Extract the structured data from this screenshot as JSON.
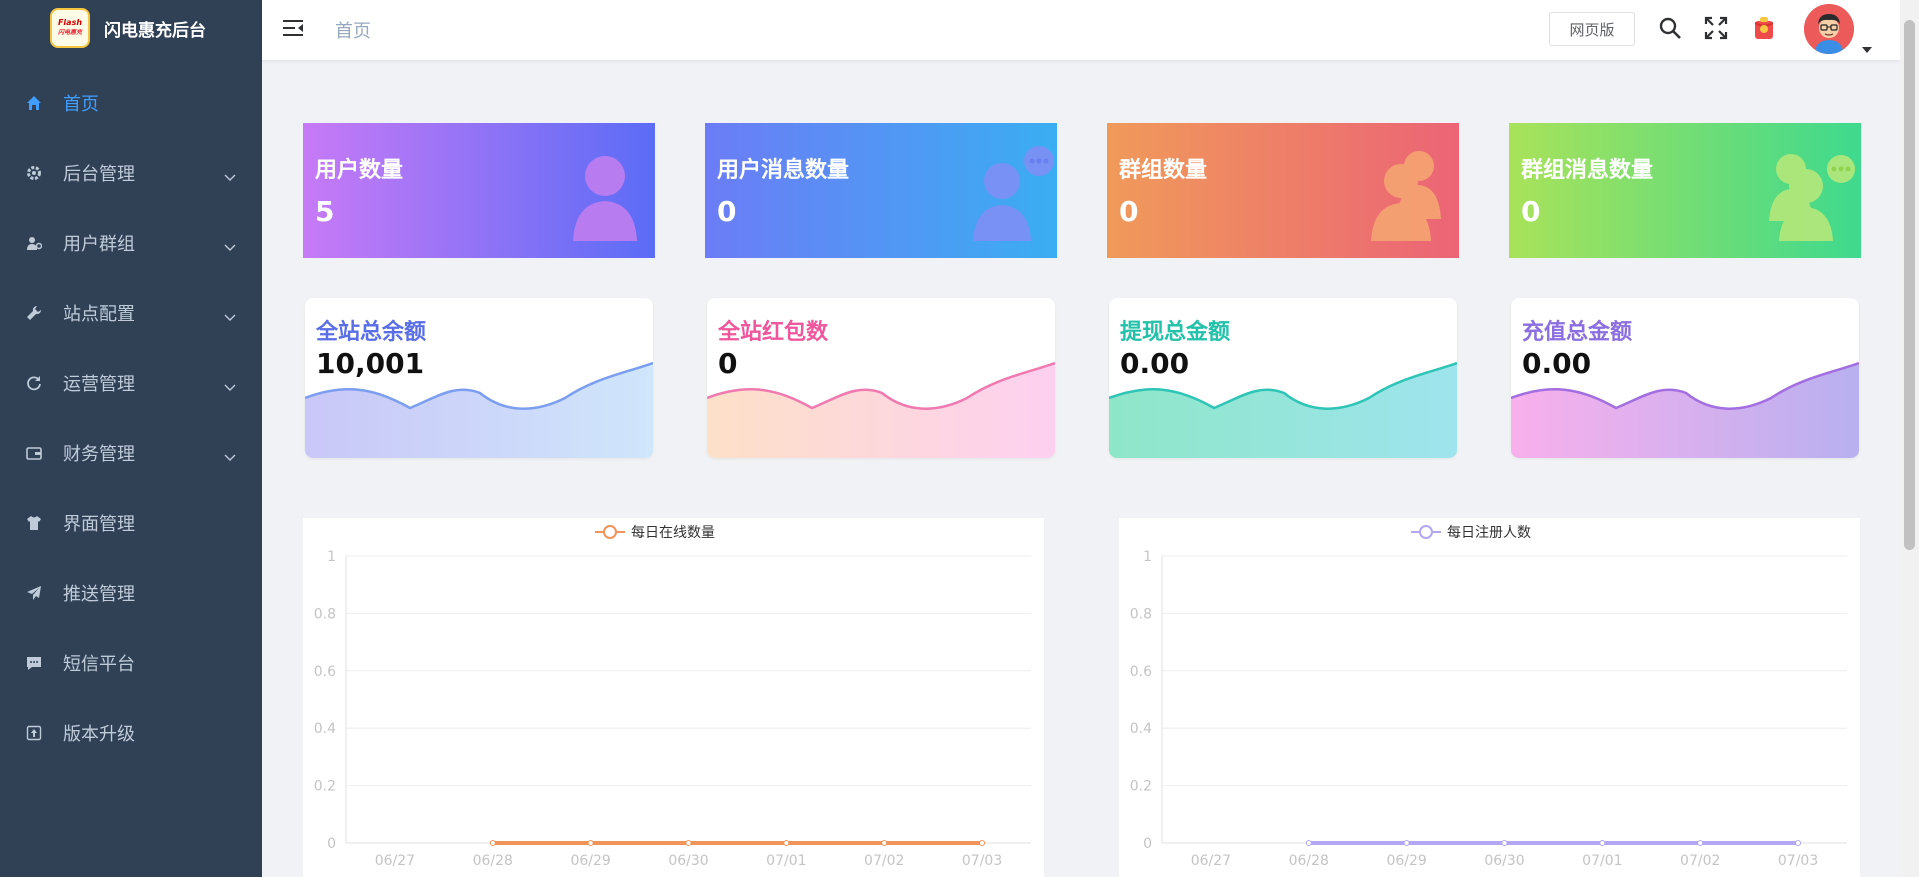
{
  "app": {
    "title": "闪电惠充后台",
    "logo_text": "Flash",
    "logo_sub": "闪电惠充"
  },
  "sidebar": {
    "items": [
      {
        "label": "首页",
        "icon": "home-icon",
        "active": true,
        "has_children": false
      },
      {
        "label": "后台管理",
        "icon": "gear-icon",
        "active": false,
        "has_children": true
      },
      {
        "label": "用户群组",
        "icon": "user-group-icon",
        "active": false,
        "has_children": true
      },
      {
        "label": "站点配置",
        "icon": "wrench-icon",
        "active": false,
        "has_children": true
      },
      {
        "label": "运营管理",
        "icon": "refresh-icon",
        "active": false,
        "has_children": true
      },
      {
        "label": "财务管理",
        "icon": "wallet-icon",
        "active": false,
        "has_children": true
      },
      {
        "label": "界面管理",
        "icon": "shirt-icon",
        "active": false,
        "has_children": false
      },
      {
        "label": "推送管理",
        "icon": "send-icon",
        "active": false,
        "has_children": false
      },
      {
        "label": "短信平台",
        "icon": "message-icon",
        "active": false,
        "has_children": false
      },
      {
        "label": "版本升级",
        "icon": "upload-icon",
        "active": false,
        "has_children": false
      }
    ]
  },
  "header": {
    "breadcrumb": "首页",
    "web_button": "网页版"
  },
  "stats": [
    {
      "label": "用户数量",
      "value": "5"
    },
    {
      "label": "用户消息数量",
      "value": "0"
    },
    {
      "label": "群组数量",
      "value": "0"
    },
    {
      "label": "群组消息数量",
      "value": "0"
    }
  ],
  "finance": [
    {
      "label": "全站总余额",
      "value": "10,001",
      "color": "#5a6ee8"
    },
    {
      "label": "全站红包数",
      "value": "0",
      "color": "#f0569b"
    },
    {
      "label": "提现总金额",
      "value": "0.00",
      "color": "#22c1aa"
    },
    {
      "label": "充值总金额",
      "value": "0.00",
      "color": "#8b6fe0"
    }
  ],
  "chart_data": [
    {
      "type": "line",
      "legend": "每日在线数量",
      "color": "#f0945a",
      "categories": [
        "06/27",
        "06/28",
        "06/29",
        "06/30",
        "07/01",
        "07/02",
        "07/03"
      ],
      "values": [
        null,
        0,
        0,
        0,
        0,
        0,
        0
      ],
      "yticks": [
        "0",
        "0.2",
        "0.4",
        "0.6",
        "0.8",
        "1"
      ],
      "ylim": [
        0,
        1
      ]
    },
    {
      "type": "line",
      "legend": "每日注册人数",
      "color": "#b3a6f2",
      "categories": [
        "06/27",
        "06/28",
        "06/29",
        "06/30",
        "07/01",
        "07/02",
        "07/03"
      ],
      "values": [
        null,
        0,
        0,
        0,
        0,
        0,
        0
      ],
      "yticks": [
        "0",
        "0.2",
        "0.4",
        "0.6",
        "0.8",
        "1"
      ],
      "ylim": [
        0,
        1
      ]
    }
  ]
}
